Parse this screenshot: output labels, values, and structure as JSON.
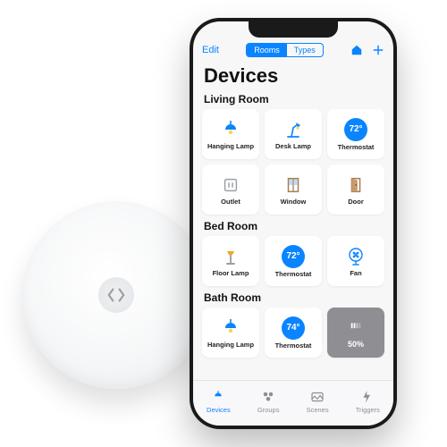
{
  "hub": {
    "logo": "home-outline"
  },
  "navbar": {
    "edit": "Edit",
    "segments": [
      "Rooms",
      "Types"
    ],
    "active_segment": 0
  },
  "page_title": "Devices",
  "sections": [
    {
      "name": "Living Room",
      "tiles": [
        {
          "icon": "pendant-lamp",
          "label": "Hanging Lamp",
          "color": "#0a84ff"
        },
        {
          "icon": "desk-lamp",
          "label": "Desk Lamp",
          "color": "#f5a623"
        },
        {
          "icon": "thermostat",
          "label": "Thermostat",
          "value": "72°",
          "color": "#0a84ff"
        },
        {
          "icon": "outlet",
          "label": "Outlet",
          "color": "#888"
        },
        {
          "icon": "window",
          "label": "Window",
          "color": "#a87c4f"
        },
        {
          "icon": "door",
          "label": "Door",
          "color": "#a87c4f"
        }
      ]
    },
    {
      "name": "Bed Room",
      "tiles": [
        {
          "icon": "floor-lamp",
          "label": "Floor Lamp",
          "color": "#f5a623"
        },
        {
          "icon": "thermostat",
          "label": "Thermostat",
          "value": "72°",
          "color": "#0a84ff"
        },
        {
          "icon": "fan",
          "label": "Fan",
          "color": "#0a84ff"
        }
      ]
    },
    {
      "name": "Bath Room",
      "tiles": [
        {
          "icon": "pendant-lamp",
          "label": "Hanging Lamp",
          "color": "#0a84ff"
        },
        {
          "icon": "thermostat",
          "label": "Thermostat",
          "value": "74°",
          "color": "#0a84ff"
        },
        {
          "icon": "dimmer",
          "label": "50%",
          "value": "50%"
        }
      ]
    }
  ],
  "tabbar": {
    "items": [
      {
        "icon": "devices-icon",
        "label": "Devices",
        "active": true
      },
      {
        "icon": "groups-icon",
        "label": "Groups",
        "active": false
      },
      {
        "icon": "scenes-icon",
        "label": "Scenes",
        "active": false
      },
      {
        "icon": "triggers-icon",
        "label": "Triggers",
        "active": false
      }
    ]
  }
}
